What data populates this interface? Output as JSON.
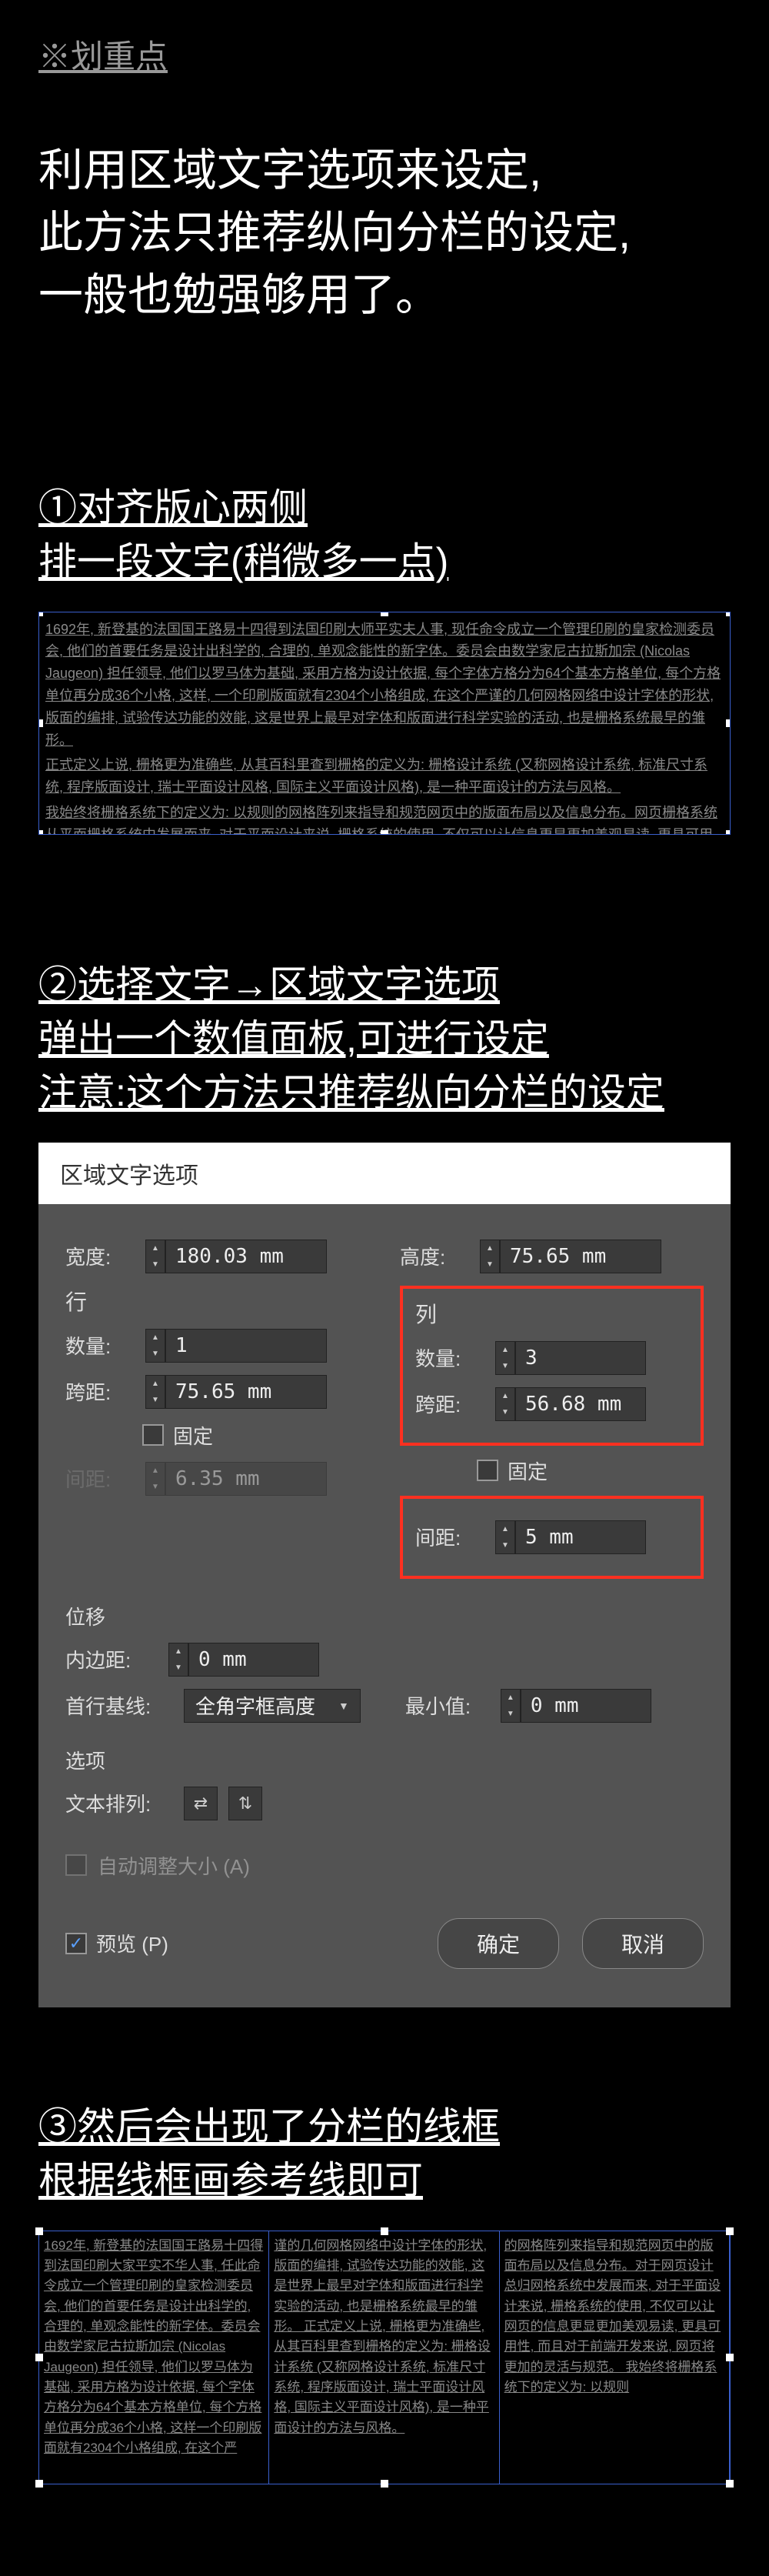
{
  "header": {
    "highlight_label": "※划重点",
    "big_text_l1": "利用区域文字选项来设定,",
    "big_text_l2": "此方法只推荐纵向分栏的设定,",
    "big_text_l3": "一般也勉强够用了。"
  },
  "step1": {
    "title_l1": "①对齐版心两侧",
    "title_l2": "排一段文字(稍微多一点)",
    "body_p1": "1692年, 新登基的法国国王路易十四得到法国印刷大师平实夫人事, 现任命令成立一个管理印刷的皇家检测委员会, 他们的首要任务是设计出科学的, 合理的, 单观念能性的新字体。委员会由数学家尼古拉斯加宗 (Nicolas Jaugeon) 担任领导, 他们以罗马体为基础, 采用方格为设计依据, 每个字体方格分为64个基本方格单位, 每个方格单位再分成36个小格, 这样, 一个印刷版面就有2304个小格组成, 在这个严谨的几何网格网络中设计字体的形状, 版面的编排, 试验传达功能的效能, 这是世界上最早对字体和版面进行科学实验的活动, 也是栅格系统最早的雏形。",
    "body_p2": "正式定义上说, 栅格更为准确些, 从其百科里查到栅格的定义为: 栅格设计系统 (又称网格设计系统, 标准尺寸系统, 程序版面设计, 瑞士平面设计风格, 国际主义平面设计风格), 是一种平面设计的方法与风格。",
    "body_p3": "我始终将栅格系统下的定义为: 以规则的网格阵列来指导和规范网页中的版面布局以及信息分布。网页栅格系统从平面栅格系统中发展而来, 对于平面设计来说, 栅格系统的使用, 不仅可以让信息更显更加美观易读, 更具可用性, 而且对于前端开发来说, 网页将更加的灵活与规范。"
  },
  "step2": {
    "title_l1": "②选择文字→区域文字选项",
    "title_l2": "弹出一个数值面板,可进行设定",
    "title_l3": "注意:这个方法只推荐纵向分栏的设定"
  },
  "dialog": {
    "title": "区域文字选项",
    "width_label": "宽度:",
    "width_value": "180.03 mm",
    "height_label": "高度:",
    "height_value": "75.65 mm",
    "rows_group": "行",
    "cols_group": "列",
    "count_label": "数量:",
    "rows_count": "1",
    "cols_count": "3",
    "span_label": "跨距:",
    "rows_span": "75.65 mm",
    "cols_span": "56.68 mm",
    "fixed_label": "固定",
    "gutter_label": "间距:",
    "rows_gutter": "6.35 mm",
    "cols_gutter": "5 mm",
    "offset_group": "位移",
    "inset_label": "内边距:",
    "inset_value": "0 mm",
    "baseline_label": "首行基线:",
    "baseline_value": "全角字框高度",
    "min_label": "最小值:",
    "min_value": "0 mm",
    "options_group": "选项",
    "textflow_label": "文本排列:",
    "autosize_label": "自动调整大小 (A)",
    "preview_label": "预览 (P)",
    "ok": "确定",
    "cancel": "取消"
  },
  "step3": {
    "title_l1": "③然后会出现了分栏的线框",
    "title_l2": "根据线框画参考线即可",
    "col1": "1692年, 新登基的法国国王路易十四得到法国印刷大家平实不华人事, 任此命令成立一个管理印刷的皇家检测委员会, 他们的首要任务是设计出科学的, 合理的, 单观念能性的新字体。委员会由数学家尼古拉斯加宗 (Nicolas Jaugeon) 担任领导, 他们以罗马体为基础, 采用方格为设计依据, 每个字体方格分为64个基本方格单位, 每个方格单位再分成36个小格, 这样一个印刷版面就有2304个小格组成, 在这个严",
    "col2": "谨的几何网格网络中设计字体的形状, 版面的编排, 试验传达功能的效能, 这是世界上最早对字体和版面进行科学实验的活动, 也是栅格系统最早的雏形。\n正式定义上说, 栅格更为准确些, 从其百科里查到栅格的定义为: 栅格设计系统 (又称网格设计系统, 标准尺寸系统, 程序版面设计, 瑞士平面设计风格, 国际主义平面设计风格), 是一种平面设计的方法与风格。",
    "col3": "的网格阵列来指导和规范网页中的版面布局以及信息分布。对于网页设计总归网格系统中发展而来, 对于平面设计来说, 栅格系统的使用, 不仅可以让网页的信息更显更加美观易读, 更具可用性, 而且对于前端开发来说, 网页将更加的灵活与规范。\n我始终将栅格系统下的定义为: 以规则"
  }
}
